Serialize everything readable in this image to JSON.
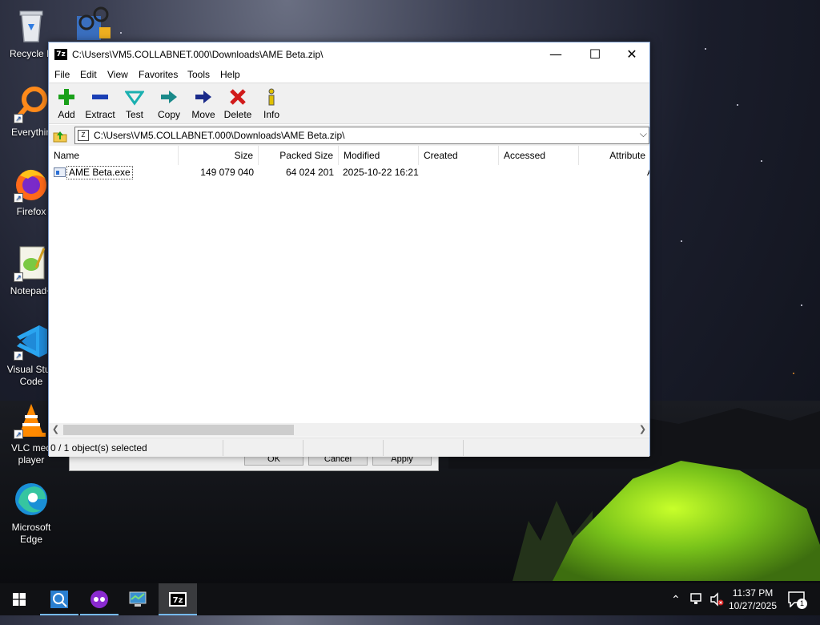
{
  "desktop": {
    "icons": [
      {
        "label": "Recycle Bin",
        "icon": "recycle-bin-icon"
      },
      {
        "label": "Everything",
        "icon": "everything-search-icon"
      },
      {
        "label": "Firefox",
        "icon": "firefox-icon"
      },
      {
        "label": "Notepad++",
        "icon": "notepad-plus-plus-icon"
      },
      {
        "label": "Visual Studio Code",
        "icon": "vscode-icon"
      },
      {
        "label": "VLC media player",
        "icon": "vlc-icon"
      },
      {
        "label": "Microsoft Edge",
        "icon": "edge-icon"
      }
    ],
    "icon_labels_visible": {
      "recycle": "Recycle B",
      "everything": "Everythin",
      "firefox": "Firefox",
      "notepad": "Notepad+",
      "vscode_line1": "Visual Stud",
      "vscode_line2": "Code",
      "vlc_line1": "VLC med",
      "vlc_line2": "player",
      "edge_line1": "Microsoft",
      "edge_line2": "Edge"
    }
  },
  "back_dialog": {
    "ok": "OK",
    "cancel": "Cancel",
    "apply": "Apply"
  },
  "window": {
    "title": "C:\\Users\\VM5.COLLABNET.000\\Downloads\\AME Beta.zip\\",
    "app_icon_text": "7z",
    "minimize": "—",
    "maximize": "☐",
    "close": "✕",
    "menu": [
      "File",
      "Edit",
      "View",
      "Favorites",
      "Tools",
      "Help"
    ],
    "toolbar": [
      {
        "label": "Add",
        "icon": "add-icon",
        "color": "#1aa01a"
      },
      {
        "label": "Extract",
        "icon": "extract-icon",
        "color": "#1a3fb5"
      },
      {
        "label": "Test",
        "icon": "test-icon",
        "color": "#1ab0b0"
      },
      {
        "label": "Copy",
        "icon": "copy-icon",
        "color": "#1a8a8a"
      },
      {
        "label": "Move",
        "icon": "move-icon",
        "color": "#1a2a8a"
      },
      {
        "label": "Delete",
        "icon": "delete-icon",
        "color": "#d11a1a"
      },
      {
        "label": "Info",
        "icon": "info-icon",
        "color": "#e0c000"
      }
    ],
    "address": "C:\\Users\\VM5.COLLABNET.000\\Downloads\\AME Beta.zip\\",
    "columns": [
      "Name",
      "Size",
      "Packed Size",
      "Modified",
      "Created",
      "Accessed",
      "Attribute"
    ],
    "rows": [
      {
        "name": "AME Beta.exe",
        "size": "149 079 040",
        "packed": "64 024 201",
        "modified": "2025-10-22 16:21",
        "created": "",
        "accessed": "",
        "attr": "A"
      }
    ],
    "status": {
      "selection": "0 / 1 object(s) selected"
    }
  },
  "taskbar": {
    "apps": [
      {
        "icon": "start-icon",
        "active": false
      },
      {
        "icon": "everything-search-icon",
        "active": false
      },
      {
        "icon": "app-purple-icon",
        "active": false
      },
      {
        "icon": "network-monitor-icon",
        "active": false
      },
      {
        "icon": "7zip-icon",
        "active": true
      }
    ],
    "time": "11:37 PM",
    "date": "10/27/2025",
    "notification_count": "1"
  },
  "colors": {
    "window_border": "#7a9ac9",
    "taskbar_bg": "#101114",
    "active_underline": "#76b9ed"
  }
}
